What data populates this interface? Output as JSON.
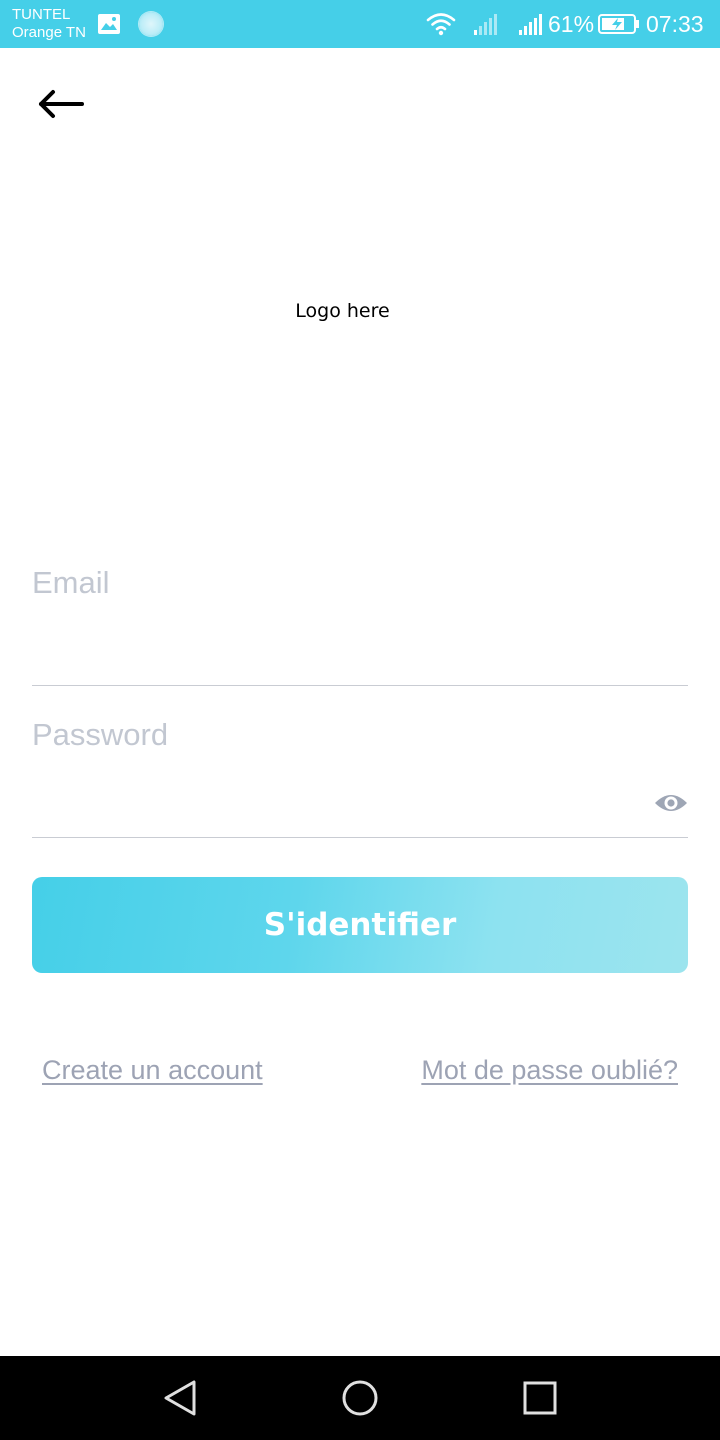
{
  "status_bar": {
    "carrier_line1": "TUNTEL",
    "carrier_line2": "Orange TN",
    "battery_percent": "61%",
    "time": "07:33",
    "background_color": "#45cfe8",
    "icons": [
      "gallery-icon",
      "sync-dot-icon",
      "wifi-icon",
      "signal-icon",
      "signal-icon",
      "battery-charging-icon"
    ]
  },
  "header": {
    "back_icon": "arrow-left-icon"
  },
  "logo": {
    "text": "Logo here"
  },
  "form": {
    "email_placeholder": "Email",
    "password_placeholder": "Password",
    "password_toggle_icon": "eye-icon",
    "submit_label": "S'identifier"
  },
  "links": {
    "create_account": "Create un account",
    "forgot_password": "Mot de passe oublié?"
  },
  "navigation_bar": {
    "icons": [
      "nav-back-icon",
      "nav-home-icon",
      "nav-recent-icon"
    ]
  },
  "colors": {
    "accent": "#45cfe8",
    "link": "#9da3b4",
    "placeholder": "#c2c7d1"
  }
}
